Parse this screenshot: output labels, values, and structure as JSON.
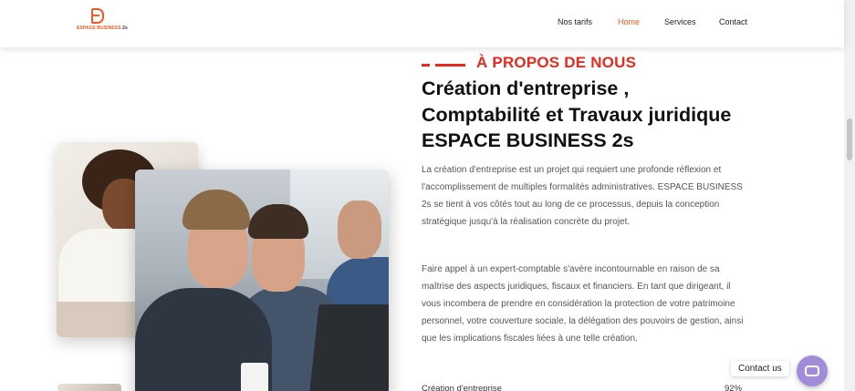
{
  "header": {
    "logo_text": "ESPACE BUSINESS",
    "logo_suffix": "2s",
    "nav": [
      {
        "label": "Nos tarifs",
        "active": false
      },
      {
        "label": "Home",
        "active": true
      },
      {
        "label": "Services",
        "active": false
      },
      {
        "label": "Contact",
        "active": false
      }
    ]
  },
  "about": {
    "eyebrow": "À PROPOS DE NOUS",
    "title": "Création d'entreprise , Comptabilité et Travaux juridique ESPACE BUSINESS 2s",
    "paragraph_1": "La création d'entreprise est un projet qui requiert une profonde réflexion et l'accomplissement de multiples formalités administratives. ESPACE BUSINESS 2s se tient à vos côtés tout au long de ce processus, depuis la conception stratégique jusqu'à la réalisation concrète du projet.",
    "paragraph_2": "Faire appel à un expert-comptable s'avère incontournable en raison de sa maîtrise des aspects juridiques, fiscaux et financiers. En tant que dirigeant, il vous incombera de prendre en considération la protection de votre patrimoine personnel, votre couverture sociale, la délégation des pouvoirs de gestion, ainsi que les implications fiscales liées à une telle création.",
    "skill": {
      "label": "Création d'entreprise",
      "percent": "92%"
    }
  },
  "contact_widget": {
    "label": "Contact us"
  },
  "colors": {
    "accent": "#e52b1f",
    "nav_active": "#f05a22",
    "widget": "#a28cd9"
  }
}
